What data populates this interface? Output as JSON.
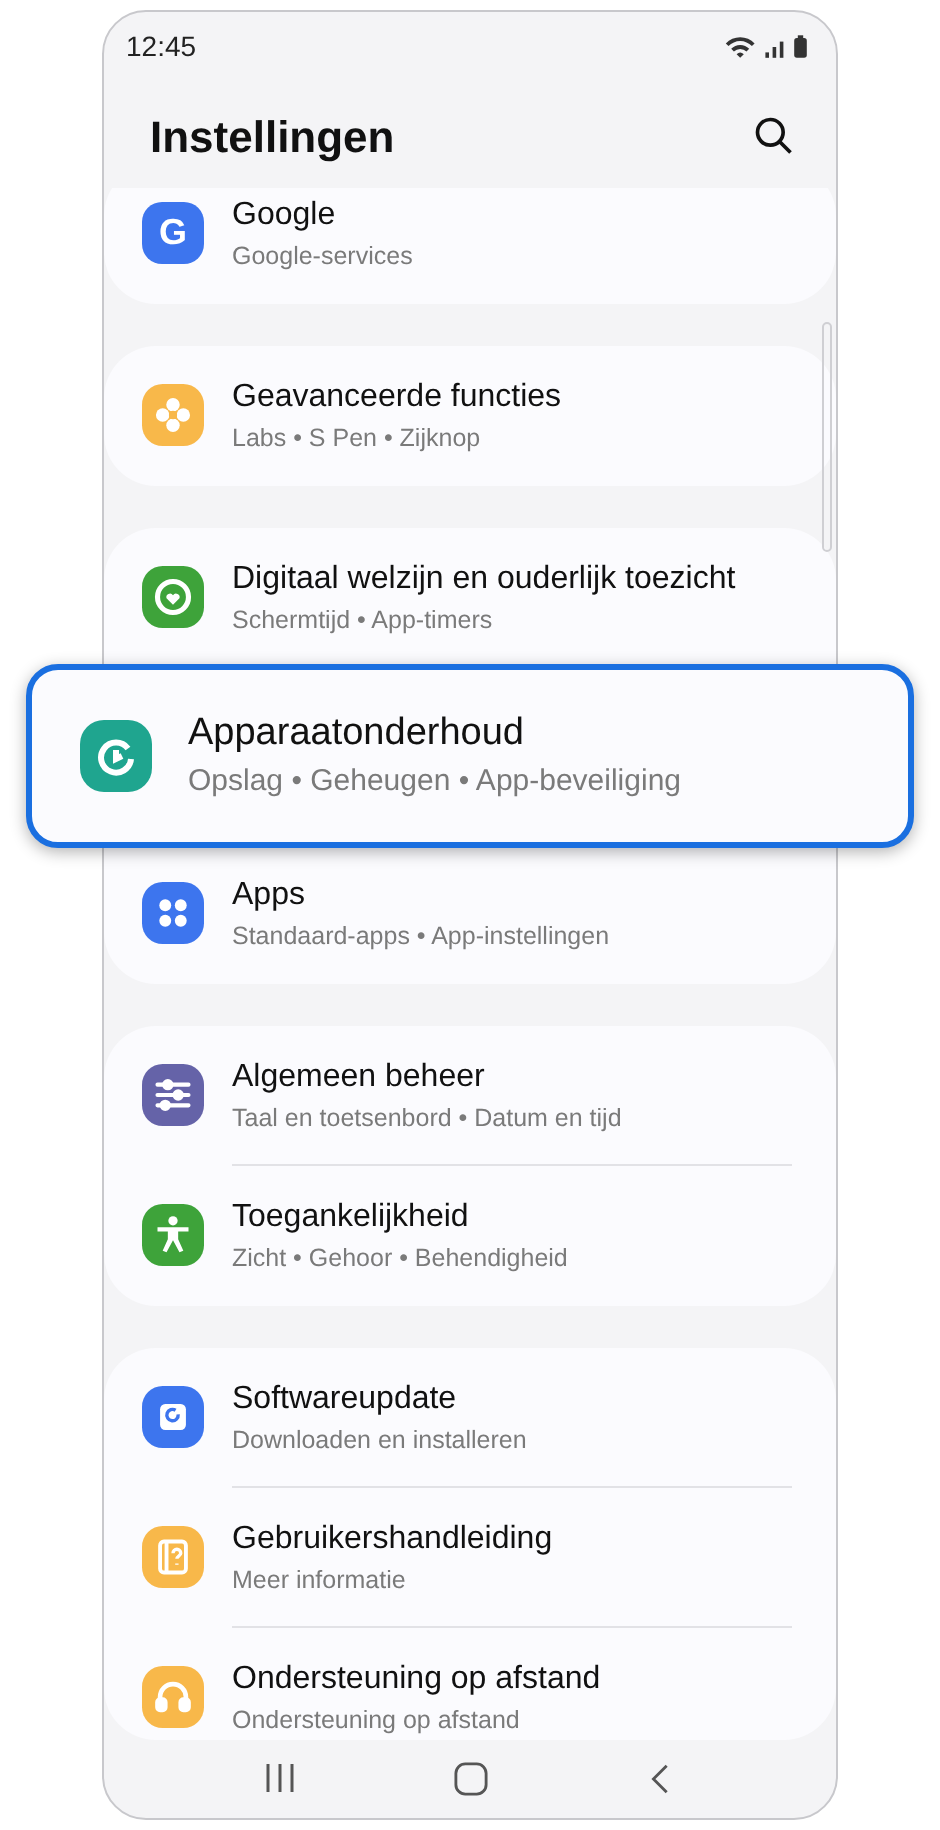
{
  "status_bar": {
    "time": "12:45"
  },
  "header": {
    "title": "Instellingen"
  },
  "groups": [
    {
      "clipped": true,
      "items": [
        {
          "title": "Google",
          "subtitle": "Google-services",
          "color": "#3d75ee",
          "icon_text": "G",
          "highlighted": false
        }
      ]
    },
    {
      "clipped": false,
      "items": [
        {
          "title": "Geavanceerde functies",
          "subtitle": "Labs • S Pen • Zijknop",
          "color": "#f8b84a",
          "highlighted": false
        }
      ]
    },
    {
      "clipped": false,
      "items": [
        {
          "title": "Digitaal welzijn en ouderlijk toezicht",
          "subtitle": "Schermtijd • App-timers",
          "color": "#3ea33a",
          "highlighted": false
        },
        {
          "title": "Apparaatonderhoud",
          "subtitle": "Opslag • Geheugen • App-beveiliging",
          "color": "#1fa58f",
          "highlighted": true
        },
        {
          "title": "Apps",
          "subtitle": "Standaard-apps • App-instellingen",
          "color": "#3d75ee",
          "highlighted": false
        }
      ]
    },
    {
      "clipped": false,
      "items": [
        {
          "title": "Algemeen beheer",
          "subtitle": "Taal en toetsenbord • Datum en tijd",
          "color": "#6563a8",
          "highlighted": false
        },
        {
          "title": "Toegankelijkheid",
          "subtitle": "Zicht • Gehoor • Behendigheid",
          "color": "#3ea33a",
          "highlighted": false
        }
      ]
    },
    {
      "clipped": true,
      "items": [
        {
          "title": "Softwareupdate",
          "subtitle": "Downloaden en installeren",
          "color": "#3d75ee",
          "highlighted": false
        },
        {
          "title": "Gebruikershandleiding",
          "subtitle": "Meer informatie",
          "color": "#f8b84a",
          "highlighted": false
        },
        {
          "title": "Ondersteuning op afstand",
          "subtitle": "Ondersteuning op afstand",
          "color": "#f8b84a",
          "highlighted": false
        }
      ]
    }
  ]
}
